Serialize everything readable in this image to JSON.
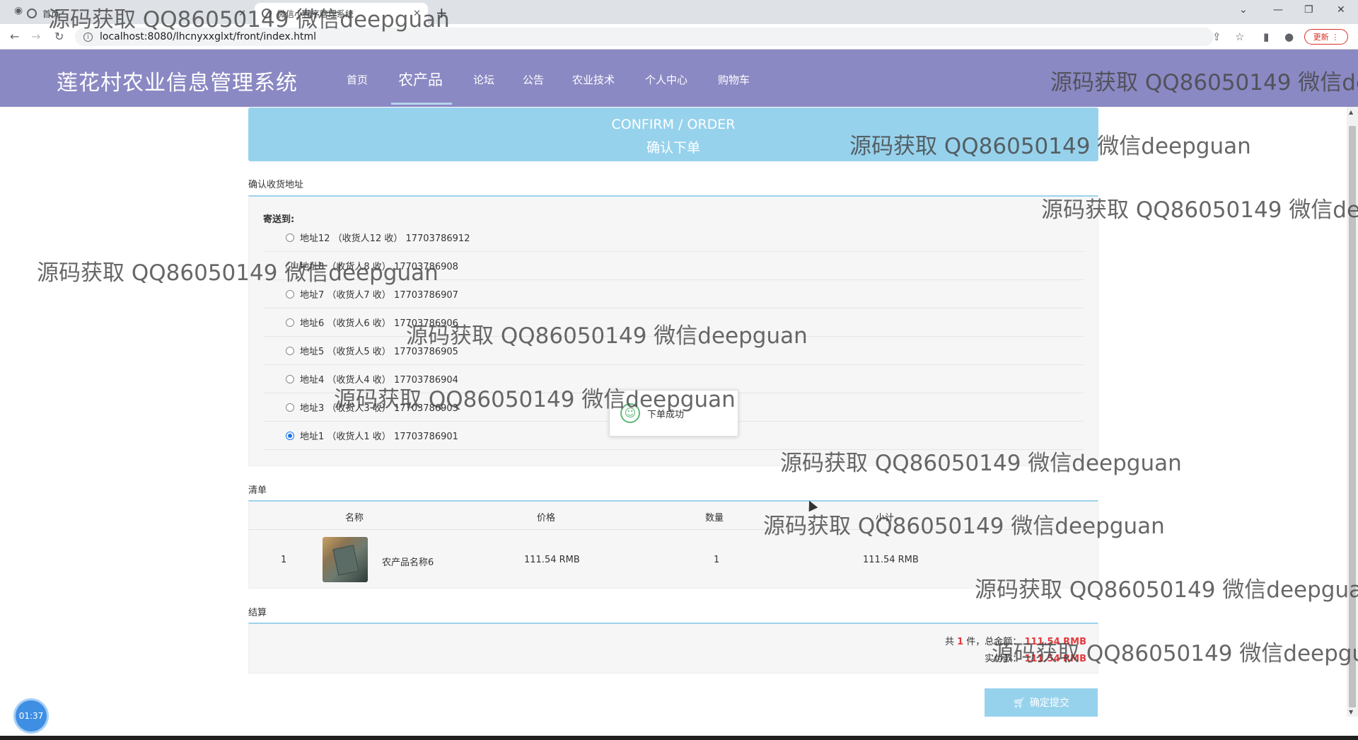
{
  "browser": {
    "tabs": [
      {
        "label": "首页"
      },
      {
        "label": "微信小程序管理系统"
      }
    ],
    "url": "localhost:8080/lhcnyxxglxt/front/index.html",
    "update_label": "更新"
  },
  "header": {
    "title": "莲花村农业信息管理系统",
    "nav": [
      "首页",
      "农产品",
      "论坛",
      "公告",
      "农业技术",
      "个人中心",
      "购物车"
    ],
    "active_nav": "农产品"
  },
  "banner": {
    "en": "CONFIRM / ORDER",
    "zh": "确认下单"
  },
  "address_section": {
    "label": "确认收货地址",
    "send_to": "寄送到:",
    "addresses": [
      {
        "text": "地址12 （收货人12 收） 17703786912",
        "selected": false
      },
      {
        "text": "地址8 （收货人8 收） 17703786908",
        "selected": false
      },
      {
        "text": "地址7 （收货人7 收） 17703786907",
        "selected": false
      },
      {
        "text": "地址6 （收货人6 收） 17703786906",
        "selected": false
      },
      {
        "text": "地址5 （收货人5 收） 17703786905",
        "selected": false
      },
      {
        "text": "地址4 （收货人4 收） 17703786904",
        "selected": false
      },
      {
        "text": "地址3 （收货人3 收） 17703786903",
        "selected": false
      },
      {
        "text": "地址1 （收货人1 收） 17703786901",
        "selected": true
      }
    ]
  },
  "list_section": {
    "label": "清单",
    "columns": [
      "名称",
      "价格",
      "数量",
      "小计"
    ],
    "rows": [
      {
        "index": "1",
        "name": "农产品名称6",
        "price": "111.54 RMB",
        "quantity": "1",
        "subtotal": "111.54 RMB"
      }
    ]
  },
  "checkout_section": {
    "label": "结算",
    "count_prefix": "共",
    "count": "1",
    "count_suffix": "件，总金额：",
    "total": "111.54 RMB",
    "pay_prefix": "实付款：",
    "pay": "111.54 RMB"
  },
  "submit_label": "确定提交",
  "toast": {
    "message": "下单成功"
  },
  "clock": "01:37",
  "watermark": "源码获取 QQ86050149 微信deepguan"
}
